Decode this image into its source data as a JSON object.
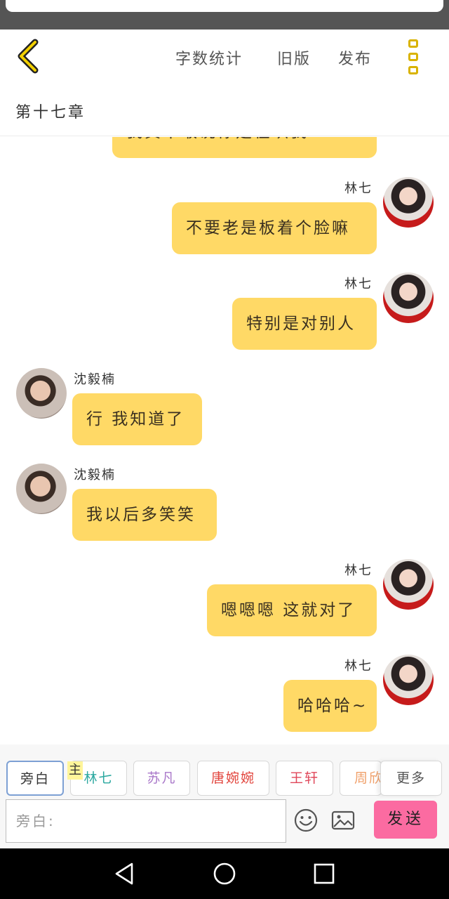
{
  "header": {
    "word_count": "字数统计",
    "old_version": "旧版",
    "publish": "发布",
    "chapter_title": "第十七章"
  },
  "messages": [
    {
      "side": "right",
      "speaker": "",
      "text": "我真不敢说你是在哄我"
    },
    {
      "side": "right",
      "speaker": "林七",
      "text": "不要老是板着个脸嘛"
    },
    {
      "side": "right",
      "speaker": "林七",
      "text": "特别是对别人"
    },
    {
      "side": "left",
      "speaker": "沈毅楠",
      "text": "行 我知道了"
    },
    {
      "side": "left",
      "speaker": "沈毅楠",
      "text": "我以后多笑笑"
    },
    {
      "side": "right",
      "speaker": "林七",
      "text": "嗯嗯嗯 这就对了"
    },
    {
      "side": "right",
      "speaker": "林七",
      "text": "哈哈哈~"
    }
  ],
  "characters": {
    "narrator": "旁白",
    "protagonist_badge": "主",
    "items": [
      {
        "label": "林七",
        "color": "#2ba8a0"
      },
      {
        "label": "苏凡",
        "color": "#a977c9"
      },
      {
        "label": "唐婉婉",
        "color": "#e2453d"
      },
      {
        "label": "王轩",
        "color": "#e0475a"
      },
      {
        "label": "周欣",
        "color": "#f0a06a"
      }
    ],
    "more": "更多"
  },
  "input": {
    "placeholder": "旁白:",
    "send": "发送"
  },
  "colors": {
    "bubble": "#ffd966",
    "accent": "#d9b300",
    "send": "#fb6ba1"
  },
  "icons": [
    "back-chevron-icon",
    "more-vertical-icon",
    "emoji-icon",
    "image-icon",
    "nav-back-icon",
    "nav-home-icon",
    "nav-recents-icon"
  ]
}
